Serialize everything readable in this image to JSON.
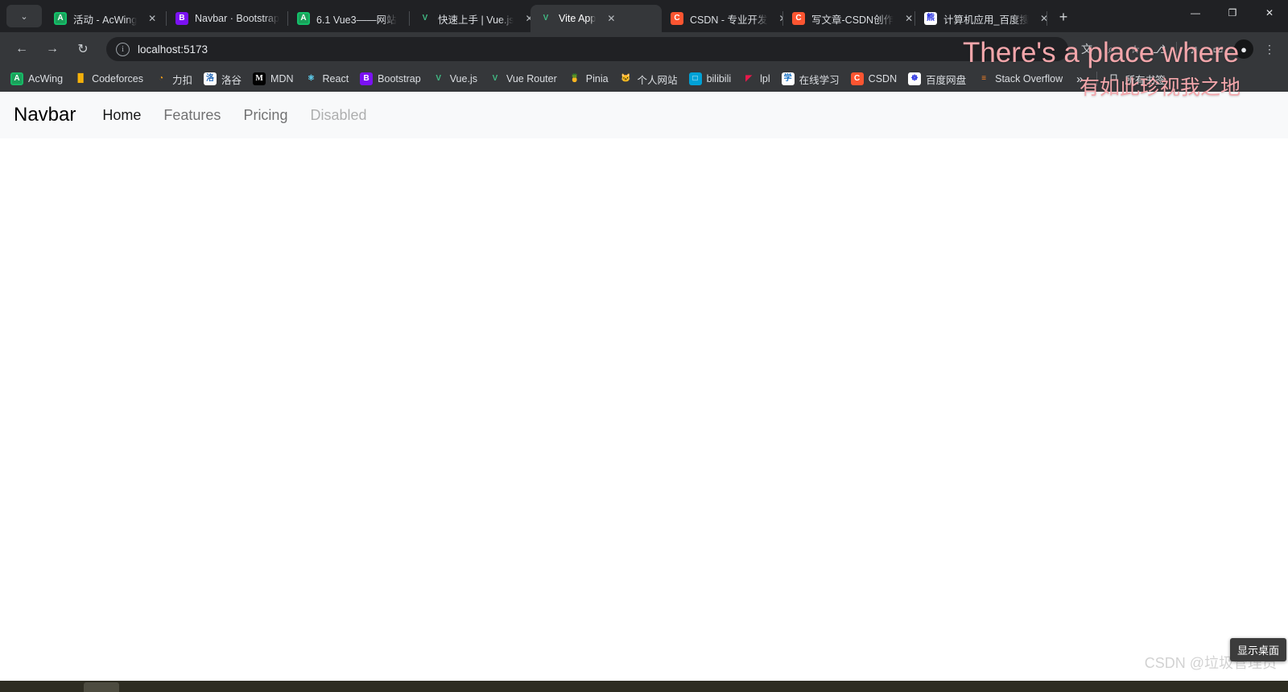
{
  "window": {
    "controls": [
      {
        "name": "minimize-button",
        "glyph": "—"
      },
      {
        "name": "maximize-button",
        "glyph": "❐"
      },
      {
        "name": "close-button",
        "glyph": "✕"
      }
    ],
    "tab_search_icon": "⌄",
    "new_tab_icon": "+"
  },
  "tabs": [
    {
      "title": "活动 - AcWing",
      "icon": "A",
      "icon_class": "fv-acwing",
      "active": false,
      "close": "✕"
    },
    {
      "title": "Navbar · Bootstrap",
      "icon": "B",
      "icon_class": "fv-b",
      "active": false,
      "close": "✕"
    },
    {
      "title": "6.1 Vue3——网站",
      "icon": "A",
      "icon_class": "fv-acwing",
      "active": false,
      "close": "✕"
    },
    {
      "title": "快速上手 | Vue.js",
      "icon": "V",
      "icon_class": "fv-vue",
      "active": false,
      "close": "✕"
    },
    {
      "title": "Vite App",
      "icon": "V",
      "icon_class": "fv-vue",
      "active": true,
      "close": "✕"
    },
    {
      "title": "CSDN - 专业开发",
      "icon": "C",
      "icon_class": "fv-csdn",
      "active": false,
      "close": "✕"
    },
    {
      "title": "写文章-CSDN创作",
      "icon": "C",
      "icon_class": "fv-csdn",
      "active": false,
      "close": "✕"
    },
    {
      "title": "计算机应用_百度搜",
      "icon": "熊",
      "icon_class": "fv-baidu",
      "active": false,
      "close": "✕"
    }
  ],
  "toolbar": {
    "back_icon": "←",
    "forward_icon": "→",
    "reload_icon": "↻",
    "site_info_icon": "i",
    "url": "localhost:5173",
    "right_icons": [
      {
        "name": "translate-icon",
        "glyph": "文"
      },
      {
        "name": "zoom-search-icon",
        "glyph": "⌕"
      },
      {
        "name": "bookmark-star-icon",
        "glyph": "☆"
      },
      {
        "name": "extensions-icon",
        "glyph": "⎇"
      },
      {
        "name": "media-list-icon",
        "glyph": "♫"
      },
      {
        "name": "side-panel-icon",
        "glyph": "▭"
      }
    ],
    "avatar_glyph": "●",
    "menu_icon": "⋮"
  },
  "bookmarks": {
    "items": [
      {
        "label": "AcWing",
        "icon": "A",
        "icon_class": "ic-acwing"
      },
      {
        "label": "Codeforces",
        "icon": "▐▌",
        "icon_class": "ic-cf"
      },
      {
        "label": "力扣",
        "icon": "◔",
        "icon_class": "ic-lk"
      },
      {
        "label": "洛谷",
        "icon": "洛",
        "icon_class": "ic-lg"
      },
      {
        "label": "MDN",
        "icon": "M",
        "icon_class": "ic-mdn"
      },
      {
        "label": "React",
        "icon": "⚛",
        "icon_class": "ic-react"
      },
      {
        "label": "Bootstrap",
        "icon": "B",
        "icon_class": "ic-bs"
      },
      {
        "label": "Vue.js",
        "icon": "V",
        "icon_class": "ic-vue"
      },
      {
        "label": "Vue Router",
        "icon": "V",
        "icon_class": "ic-vue"
      },
      {
        "label": "Pinia",
        "icon": "🍍",
        "icon_class": "ic-pinia"
      },
      {
        "label": "个人网站",
        "icon": "🐱",
        "icon_class": "ic-site"
      },
      {
        "label": "bilibili",
        "icon": "□",
        "icon_class": "ic-bili"
      },
      {
        "label": "lpl",
        "icon": "◤",
        "icon_class": "ic-lpl"
      },
      {
        "label": "在线学习",
        "icon": "学",
        "icon_class": "ic-study"
      },
      {
        "label": "CSDN",
        "icon": "C",
        "icon_class": "ic-csdn"
      },
      {
        "label": "百度网盘",
        "icon": "☸",
        "icon_class": "ic-bd"
      },
      {
        "label": "Stack Overflow",
        "icon": "≡",
        "icon_class": "ic-so"
      }
    ],
    "overflow_icon": "»",
    "all_bookmarks_label": "所有书签",
    "all_bookmarks_icon": "☐"
  },
  "page": {
    "navbar": {
      "brand": "Navbar",
      "links": [
        {
          "label": "Home",
          "state": "active"
        },
        {
          "label": "Features",
          "state": "normal"
        },
        {
          "label": "Pricing",
          "state": "normal"
        },
        {
          "label": "Disabled",
          "state": "disabled"
        }
      ]
    }
  },
  "overlays": {
    "lyric_en": "There's a place where",
    "lyric_zh": "有如此珍视我之地",
    "watermark": "CSDN @垃圾管理员",
    "show_desktop_tooltip": "显示桌面"
  },
  "colors": {
    "chrome_bg": "#202124",
    "toolbar_bg": "#35373a",
    "page_bg": "#ffffff",
    "navbar_bg": "#f8f9fa",
    "lyric_pink": "#f3a6ab",
    "vue_green": "#41b883"
  }
}
